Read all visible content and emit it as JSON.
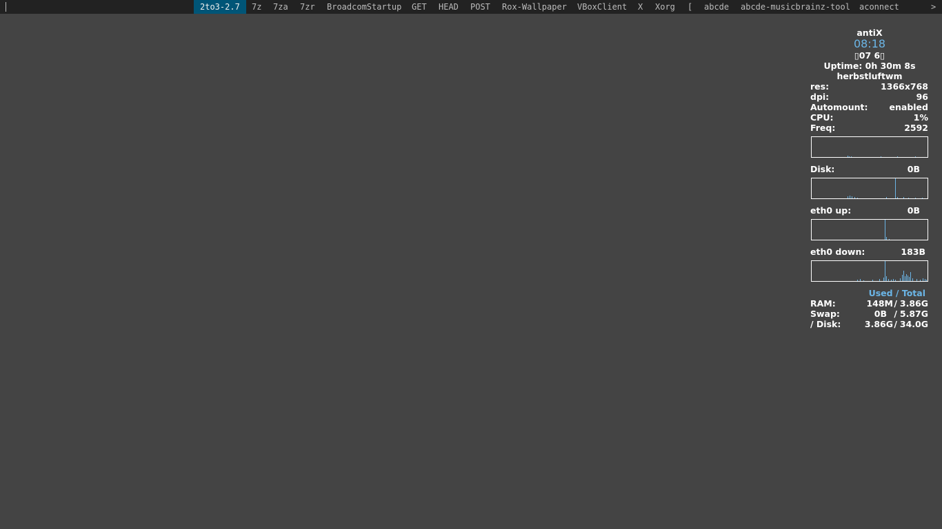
{
  "dmenu": {
    "items": [
      {
        "label": "2to3-2.7",
        "selected": true
      },
      {
        "label": "7z"
      },
      {
        "label": "7za"
      },
      {
        "label": "7zr"
      },
      {
        "label": "BroadcomStartup"
      },
      {
        "label": "GET"
      },
      {
        "label": "HEAD"
      },
      {
        "label": "POST"
      },
      {
        "label": "Rox-Wallpaper"
      },
      {
        "label": "VBoxClient"
      },
      {
        "label": "X"
      },
      {
        "label": "Xorg"
      },
      {
        "label": "["
      },
      {
        "label": "abcde"
      },
      {
        "label": "abcde-musicbrainz-tool"
      },
      {
        "label": "aconnect"
      }
    ],
    "more_indicator": ">",
    "selected_bg": "#005577",
    "bar_bg": "#222222"
  },
  "conky": {
    "hostname": "antiX",
    "time": "08:18",
    "date": "▯07  6▯",
    "uptime": "Uptime: 0h 30m 8s",
    "wm": "herbstluftwm",
    "info": [
      {
        "label": "res:",
        "value": "1366x768"
      },
      {
        "label": "dpi:",
        "value": "96"
      },
      {
        "label": "Automount:",
        "value": "enabled"
      },
      {
        "label": "CPU:",
        "value": "1%"
      },
      {
        "label": "Freq:",
        "value": "2592"
      }
    ],
    "disk": {
      "label": "Disk:",
      "value": "0B"
    },
    "eth_up": {
      "label": "eth0 up:",
      "value": "0B"
    },
    "eth_down": {
      "label": "eth0 down:",
      "value": "183B"
    },
    "mem_header": "Used / Total",
    "mem": [
      {
        "label": "RAM:",
        "used": "148M",
        "total": "3.86G"
      },
      {
        "label": "Swap:",
        "used": "0B",
        "total": "5.87G"
      },
      {
        "label": "/ Disk:",
        "used": "3.86G",
        "total": "34.0G"
      }
    ],
    "accent_color": "#6bb5e6",
    "desktop_bg": "#444444"
  }
}
